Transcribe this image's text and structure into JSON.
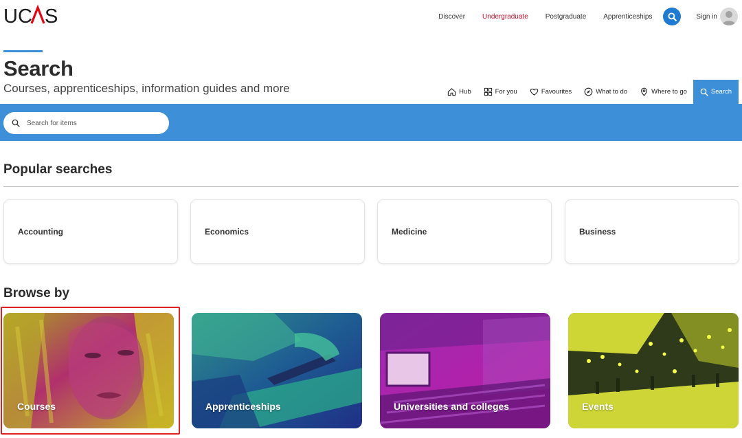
{
  "brand": {
    "name": "UCAS"
  },
  "topnav": {
    "items": [
      {
        "label": "Discover",
        "active": false
      },
      {
        "label": "Undergraduate",
        "active": true
      },
      {
        "label": "Postgraduate",
        "active": false
      },
      {
        "label": "Apprenticeships",
        "active": false
      }
    ],
    "search_icon": "search-icon",
    "signin_label": "Sign in"
  },
  "page": {
    "title": "Search",
    "subtitle": "Courses, apprenticeships, information guides and more"
  },
  "subnav": {
    "items": [
      {
        "label": "Hub",
        "icon": "home-icon"
      },
      {
        "label": "For you",
        "icon": "grid-icon"
      },
      {
        "label": "Favourites",
        "icon": "heart-icon"
      },
      {
        "label": "What to do",
        "icon": "compass-icon"
      },
      {
        "label": "Where to go",
        "icon": "map-pin-icon"
      },
      {
        "label": "Search",
        "icon": "search-icon",
        "active": true
      }
    ]
  },
  "search": {
    "placeholder": "Search for items"
  },
  "popular": {
    "title": "Popular searches",
    "items": [
      "Accounting",
      "Economics",
      "Medicine",
      "Business"
    ]
  },
  "browse": {
    "title": "Browse by",
    "items": [
      {
        "label": "Courses",
        "highlighted": true
      },
      {
        "label": "Apprenticeships",
        "highlighted": false
      },
      {
        "label": "Universities and colleges",
        "highlighted": false
      },
      {
        "label": "Events",
        "highlighted": false
      }
    ]
  },
  "colors": {
    "accent_blue": "#3d8fd8",
    "active_red": "#c8102e",
    "highlight_red": "#e02020"
  }
}
